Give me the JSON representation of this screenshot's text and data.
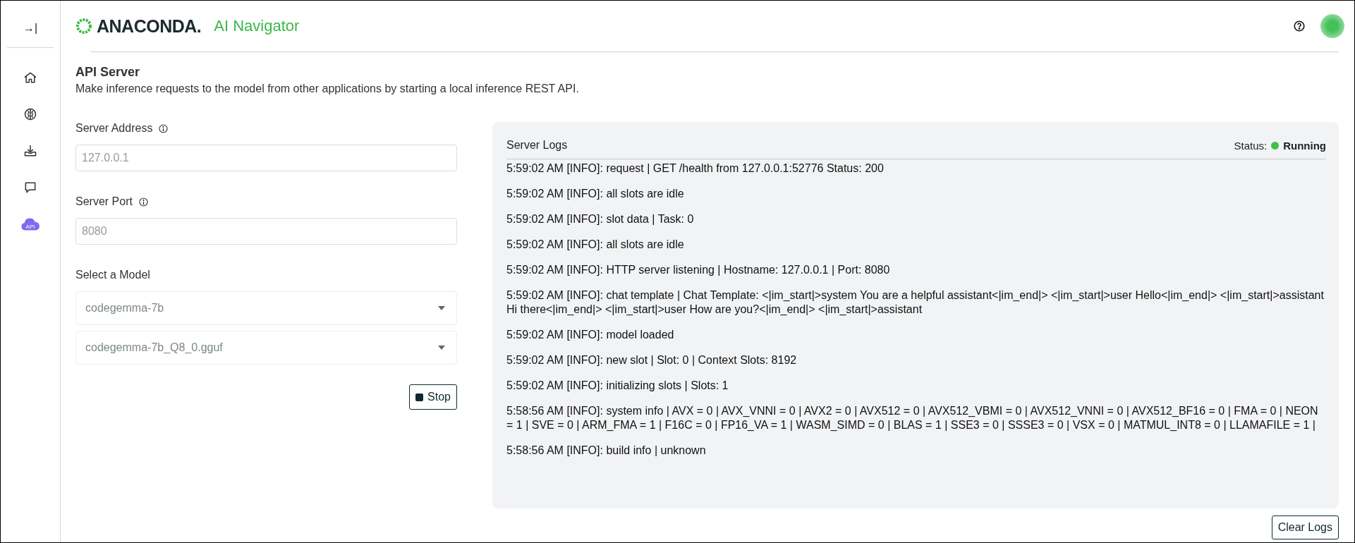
{
  "sidebar": {
    "toggle": "→|",
    "items": [
      {
        "kind": "home",
        "selected": false
      },
      {
        "kind": "brain",
        "selected": false
      },
      {
        "kind": "download",
        "selected": false
      },
      {
        "kind": "chat",
        "selected": false
      },
      {
        "kind": "api",
        "label": "API",
        "selected": true
      }
    ]
  },
  "header": {
    "brand": "ANACONDA.",
    "product": "AI Navigator"
  },
  "page": {
    "title": "API Server",
    "subtitle": "Make inference requests to the model from other applications by starting a local inference REST API."
  },
  "form": {
    "address": {
      "label": "Server Address",
      "placeholder": "127.0.0.1"
    },
    "port": {
      "label": "Server Port",
      "placeholder": "8080"
    },
    "model": {
      "label": "Select a Model",
      "selects": [
        "codegemma-7b",
        "codegemma-7b_Q8_0.gguf"
      ]
    },
    "stop_button": "Stop"
  },
  "logs": {
    "title": "Server Logs",
    "status_label": "Status:",
    "status": "Running",
    "running": true,
    "entries": [
      "5:59:02 AM [INFO]: request | GET /health from 127.0.0.1:52776 Status: 200",
      "5:59:02 AM [INFO]: all slots are idle",
      "5:59:02 AM [INFO]: slot data | Task: 0",
      "5:59:02 AM [INFO]: all slots are idle",
      "5:59:02 AM [INFO]: HTTP server listening | Hostname: 127.0.0.1 | Port: 8080",
      "5:59:02 AM [INFO]: chat template | Chat Template: <|im_start|>system You are a helpful assistant<|im_end|> <|im_start|>user Hello<|im_end|> <|im_start|>assistant Hi there<|im_end|> <|im_start|>user How are you?<|im_end|> <|im_start|>assistant",
      "5:59:02 AM [INFO]: model loaded",
      "5:59:02 AM [INFO]: new slot | Slot: 0 | Context Slots: 8192",
      "5:59:02 AM [INFO]: initializing slots | Slots: 1",
      "5:58:56 AM [INFO]: system info | AVX = 0 | AVX_VNNI = 0 | AVX2 = 0 | AVX512 = 0 | AVX512_VBMI = 0 | AVX512_VNNI = 0 | AVX512_BF16 = 0 | FMA = 0 | NEON = 1 | SVE = 0 | ARM_FMA = 1 | F16C = 0 | FP16_VA = 1 | WASM_SIMD = 0 | BLAS = 1 | SSE3 = 0 | SSSE3 = 0 | VSX = 0 | MATMUL_INT8 = 0 | LLAMAFILE = 1 |",
      "5:58:56 AM [INFO]: build info | unknown"
    ],
    "clear_button": "Clear Logs"
  }
}
